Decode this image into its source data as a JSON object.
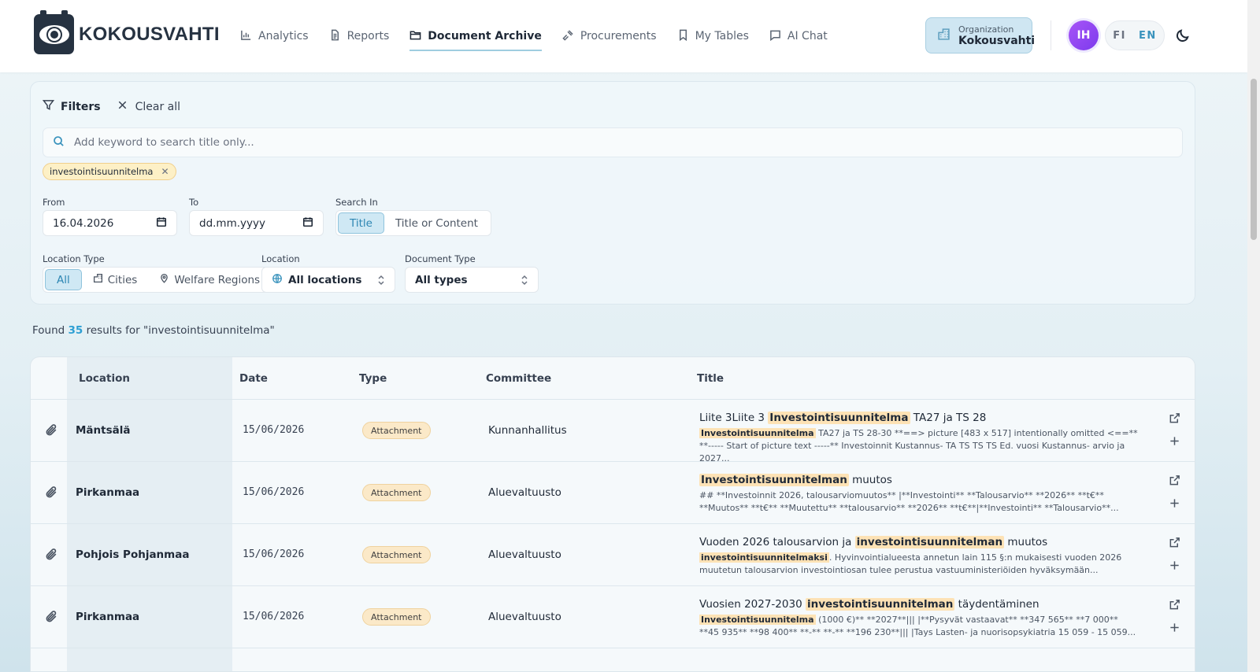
{
  "header": {
    "logo_text": "KOKOUSVAHTI",
    "nav": [
      {
        "label": "Analytics",
        "icon": "bar-chart-icon"
      },
      {
        "label": "Reports",
        "icon": "document-icon"
      },
      {
        "label": "Document Archive",
        "icon": "folder-icon",
        "active": true
      },
      {
        "label": "Procurements",
        "icon": "gavel-icon"
      },
      {
        "label": "My Tables",
        "icon": "bookmark-icon"
      },
      {
        "label": "AI Chat",
        "icon": "chat-icon"
      }
    ],
    "org_label": "Organization",
    "org_name": "Kokousvahti",
    "avatar_initials": "IH",
    "lang_fi": "FI",
    "lang_en": "EN",
    "theme_icon": "moon-icon"
  },
  "filters": {
    "filters_label": "Filters",
    "clear_label": "Clear all",
    "search_placeholder": "Add keyword to search title only...",
    "keyword_chip": "investointisuunnitelma",
    "from_label": "From",
    "from_value": "16.04.2026",
    "to_label": "To",
    "to_value": "dd.mm.yyyy",
    "search_in_label": "Search In",
    "search_in_options": [
      "Title",
      "Title or Content"
    ],
    "search_in_selected": "Title",
    "location_type_label": "Location Type",
    "location_type_options": [
      "All",
      "Cities",
      "Welfare Regions"
    ],
    "location_type_selected": "All",
    "location_label": "Location",
    "location_value": "All locations",
    "document_type_label": "Document Type",
    "document_type_value": "All types"
  },
  "results": {
    "found_prefix": "Found",
    "count": "35",
    "found_suffix": "results for \"investointisuunnitelma\""
  },
  "table": {
    "columns": [
      "Location",
      "Date",
      "Type",
      "Committee",
      "Title"
    ],
    "rows": [
      {
        "location": "Mäntsälä",
        "date": "15/06/2026",
        "type": "Attachment",
        "committee": "Kunnanhallitus",
        "title_pre": "Liite 3Liite 3 ",
        "title_hl": "Investointisuunnitelma",
        "title_post": " TA27 ja TS 28",
        "snippet_hl": "Investointisuunnitelma",
        "snippet": " TA27 ja TS 28-30 **==> picture [483 x 517] intentionally omitted <==** **----- Start of picture text -----** Investoinnit Kustannus- TA TS TS TS Ed. vuosi Kustannus- arvio ja 2027..."
      },
      {
        "location": "Pirkanmaa",
        "date": "15/06/2026",
        "type": "Attachment",
        "committee": "Aluevaltuusto",
        "title_pre": "",
        "title_hl": "Investointisuunnitelman",
        "title_post": " muutos",
        "snippet_hl": "",
        "snippet": "## **Investoinnit 2026, talousarviomuutos** |**Investointi** **Talousarvio** **2026** **t€** **Muutos** **t€** **Muutettu** **talousarvio** **2026** **t€**|**Investointi** **Talousarvio**..."
      },
      {
        "location": "Pohjois Pohjanmaa",
        "date": "15/06/2026",
        "type": "Attachment",
        "committee": "Aluevaltuusto",
        "title_pre": "Vuoden 2026 talousarvion ja ",
        "title_hl": "investointisuunnitelman",
        "title_post": " muutos",
        "snippet_hl": "investointisuunnitelmaksi",
        "snippet": ". Hyvinvointialueesta annetun lain 115 §:n mukaisesti vuoden 2026 muutetun talousarvion investointiosan tulee perustua vastuuministeriöiden hyväksymään..."
      },
      {
        "location": "Pirkanmaa",
        "date": "15/06/2026",
        "type": "Attachment",
        "committee": "Aluevaltuusto",
        "title_pre": "Vuosien 2027-2030 ",
        "title_hl": "investointisuunnitelman",
        "title_post": " täydentäminen",
        "snippet_hl": "Investointisuunnitelma",
        "snippet": " (1000 €)** **2027**||| |**Pysyvät vastaavat** **347 565** **7 000** **45 935** **98 400** **-** **-** **196 230**||| |Tays Lasten- ja nuorisopsykiatria 15 059 - 15 059..."
      }
    ]
  }
}
